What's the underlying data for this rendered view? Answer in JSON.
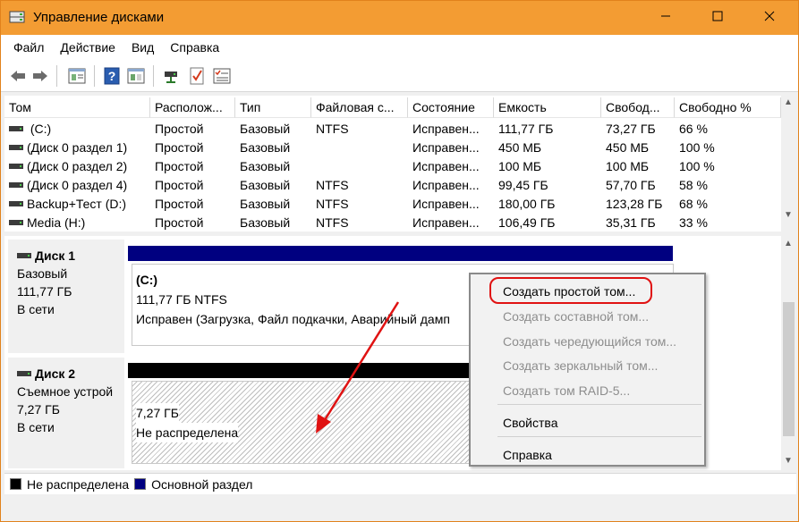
{
  "window": {
    "title": "Управление дисками",
    "controls": {
      "minimize": "—",
      "maximize": "☐",
      "close": "✕"
    }
  },
  "menubar": [
    "Файл",
    "Действие",
    "Вид",
    "Справка"
  ],
  "volume_list": {
    "columns": [
      "Том",
      "Располож...",
      "Тип",
      "Файловая с...",
      "Состояние",
      "Емкость",
      "Свобод...",
      "Свободно %"
    ],
    "rows": [
      [
        "(C:)",
        "Простой",
        "Базовый",
        "NTFS",
        "Исправен...",
        "111,77 ГБ",
        "73,27 ГБ",
        "66 %"
      ],
      [
        "(Диск 0 раздел 1)",
        "Простой",
        "Базовый",
        "",
        "Исправен...",
        "450 МБ",
        "450 МБ",
        "100 %"
      ],
      [
        "(Диск 0 раздел 2)",
        "Простой",
        "Базовый",
        "",
        "Исправен...",
        "100 МБ",
        "100 МБ",
        "100 %"
      ],
      [
        "(Диск 0 раздел 4)",
        "Простой",
        "Базовый",
        "NTFS",
        "Исправен...",
        "99,45 ГБ",
        "57,70 ГБ",
        "58 %"
      ],
      [
        "Backup+Тест (D:)",
        "Простой",
        "Базовый",
        "NTFS",
        "Исправен...",
        "180,00 ГБ",
        "123,28 ГБ",
        "68 %"
      ],
      [
        "Media (H:)",
        "Простой",
        "Базовый",
        "NTFS",
        "Исправен...",
        "106,49 ГБ",
        "35,31 ГБ",
        "33 %"
      ]
    ]
  },
  "disks": [
    {
      "name": "Диск 1",
      "type": "Базовый",
      "size": "111,77 ГБ",
      "status": "В сети",
      "partition": {
        "label": "(C:)",
        "size_fs": "111,77 ГБ NTFS",
        "state": "Исправен (Загрузка, Файл подкачки, Аварийный дамп"
      }
    },
    {
      "name": "Диск 2",
      "type": "Съемное устрой",
      "size": "7,27 ГБ",
      "status": "В сети",
      "partition": {
        "size": "7,27 ГБ",
        "state": "Не распределена"
      }
    }
  ],
  "legend": {
    "unallocated": "Не распределена",
    "primary": "Основной раздел",
    "unallocated_color": "#000000",
    "primary_color": "#000080"
  },
  "context_menu": {
    "items": [
      {
        "label": "Создать простой том...",
        "enabled": true
      },
      {
        "label": "Создать составной том...",
        "enabled": false
      },
      {
        "label": "Создать чередующийся том...",
        "enabled": false
      },
      {
        "label": "Создать зеркальный том...",
        "enabled": false
      },
      {
        "label": "Создать том RAID-5...",
        "enabled": false
      },
      {
        "label": "Свойства",
        "enabled": true
      },
      {
        "label": "Справка",
        "enabled": true
      }
    ]
  },
  "colors": {
    "titlebar": "#f39c33",
    "annotation": "#e01212",
    "primary_partition": "#000080"
  },
  "icons": [
    "back-arrow-icon",
    "forward-arrow-icon",
    "properties-icon",
    "help-icon",
    "view-icon",
    "connect-icon",
    "check-icon",
    "list-icon"
  ]
}
